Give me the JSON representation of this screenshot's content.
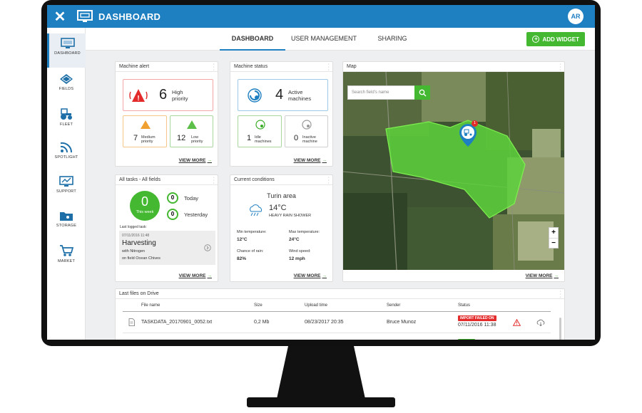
{
  "app": {
    "title": "DASHBOARD",
    "avatar_initials": "AR",
    "close_icon": "close-icon"
  },
  "sidebar": {
    "items": [
      {
        "label": "DASHBOARD",
        "icon": "dashboard-icon",
        "active": true
      },
      {
        "label": "FIELDS",
        "icon": "fields-icon"
      },
      {
        "label": "FLEET",
        "icon": "tractor-icon"
      },
      {
        "label": "SPOTLIGHT",
        "icon": "spotlight-icon"
      },
      {
        "label": "SUPPORT",
        "icon": "support-icon"
      },
      {
        "label": "STORAGE",
        "icon": "storage-icon"
      },
      {
        "label": "MARKET",
        "icon": "cart-icon"
      }
    ]
  },
  "tabs": [
    {
      "label": "DASHBOARD",
      "active": true
    },
    {
      "label": "USER MANAGEMENT"
    },
    {
      "label": "SHARING"
    }
  ],
  "add_widget": "ADD WIDGET",
  "colors": {
    "primary": "#1e7fc1",
    "accent_green": "#44b830",
    "alert_red": "#e32b2b",
    "warn_orange": "#f0a030"
  },
  "machine_alert": {
    "title": "Machine alert",
    "high_count": "6",
    "high_label_1": "High",
    "high_label_2": "priority",
    "medium_count": "7",
    "medium_label_1": "Medium",
    "medium_label_2": "priority",
    "low_count": "12",
    "low_label_1": "Low",
    "low_label_2": "priority",
    "view_more": "VIEW MORE"
  },
  "machine_status": {
    "title": "Machine status",
    "active_count": "4",
    "active_label_1": "Active",
    "active_label_2": "machines",
    "idle_count": "1",
    "idle_label_1": "Idle",
    "idle_label_2": "machines",
    "inactive_count": "0",
    "inactive_label_1": "Inactive",
    "inactive_label_2": "machine",
    "view_more": "VIEW MORE"
  },
  "map": {
    "title": "Map",
    "search_placeholder": "Search field's name",
    "marker_badge": "1",
    "zoom_in": "+",
    "zoom_out": "−",
    "view_more": "VIEW MORE"
  },
  "tasks": {
    "title": "All tasks - All fields",
    "week_count": "0",
    "week_label": "This week",
    "today_count": "0",
    "today_label": "Today",
    "yesterday_count": "0",
    "yesterday_label": "Yesterday",
    "last_logged_label": "Last logged task:",
    "last_date": "07/11/2016 11:48",
    "last_task": "Harvesting",
    "with_label": "with",
    "with_value": "Nitrogen",
    "field_label": "on field",
    "field_value": "Ocean Chives",
    "view_more": "VIEW MORE"
  },
  "conditions": {
    "title": "Current conditions",
    "location": "Turin area",
    "temp": "14°C",
    "desc": "HEAVY RAIN SHOWER",
    "min_label": "Min temperature:",
    "min_value": "12°C",
    "max_label": "Max temperature:",
    "max_value": "24°C",
    "rain_label": "Chance of rain:",
    "rain_value": "82%",
    "wind_label": "Wind speed:",
    "wind_value": "12 mph",
    "view_more": "VIEW MORE"
  },
  "files": {
    "title": "Last files on Drive",
    "columns": [
      "File name",
      "Size",
      "Upload time",
      "Sender",
      "Status"
    ],
    "rows": [
      {
        "name": "TASKDATA_20170901_0052.txt",
        "size": "0,2 Mb",
        "upload": "08/23/2017 20:35",
        "sender": "Bruce Munoz",
        "status": "IMPORT FAILED ON",
        "status_date": "07/11/2016 11:38"
      }
    ]
  }
}
